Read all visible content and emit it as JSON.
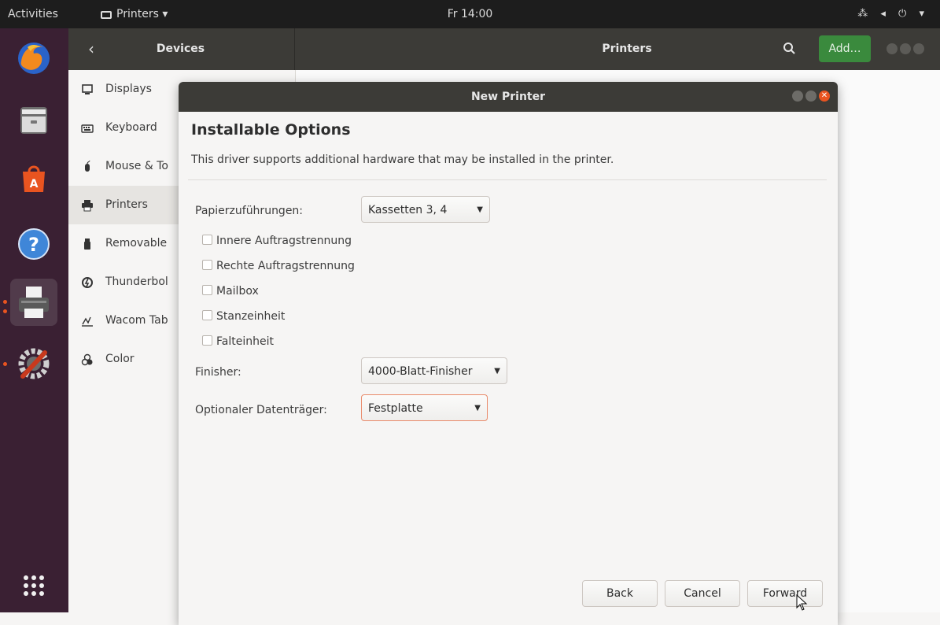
{
  "topbar": {
    "activities": "Activities",
    "app_menu": "Printers ▾",
    "clock": "Fr 14:00",
    "system_icons": "⁂ ◂ ⏻ ▾"
  },
  "dock": {
    "apps": [
      "firefox-icon",
      "files-icon",
      "software-icon",
      "help-icon",
      "printer-icon",
      "settings-icon"
    ],
    "show_apps_icon": "grid-icon"
  },
  "settings": {
    "back_label": "‹",
    "sidebar_title": "Devices",
    "page_title": "Printers",
    "add_label": "Add…",
    "sidebar": [
      {
        "label": "Displays",
        "icon": "display-icon"
      },
      {
        "label": "Keyboard",
        "icon": "keyboard-icon"
      },
      {
        "label": "Mouse & To",
        "icon": "mouse-icon"
      },
      {
        "label": "Printers",
        "icon": "printer-icon",
        "selected": true
      },
      {
        "label": "Removable",
        "icon": "removable-media-icon"
      },
      {
        "label": "Thunderbol",
        "icon": "thunderbolt-icon"
      },
      {
        "label": "Wacom Tab",
        "icon": "wacom-tablet-icon"
      },
      {
        "label": "Color",
        "icon": "color-icon"
      }
    ]
  },
  "dialog": {
    "title": "New Printer",
    "section_title": "Installable Options",
    "description": "This driver supports additional hardware that may be installed in the printer.",
    "paper_feed": {
      "label": "Papierzuführungen:",
      "value": "Kassetten 3, 4"
    },
    "checkboxes": [
      {
        "label": "Innere Auftragstrennung",
        "checked": false
      },
      {
        "label": "Rechte Auftragstrennung",
        "checked": false
      },
      {
        "label": "Mailbox",
        "checked": false
      },
      {
        "label": "Stanzeinheit",
        "checked": false
      },
      {
        "label": "Falteinheit",
        "checked": false
      }
    ],
    "finisher": {
      "label": "Finisher:",
      "value": "4000-Blatt-Finisher"
    },
    "storage": {
      "label": "Optionaler Datenträger:",
      "value": "Festplatte"
    },
    "buttons": {
      "back": "Back",
      "cancel": "Cancel",
      "forward": "Forward"
    }
  },
  "colors": {
    "accent": "#e95420",
    "add_button": "#3a8a3d",
    "dock": "#3a2033",
    "headerbar": "#3c3b37"
  }
}
